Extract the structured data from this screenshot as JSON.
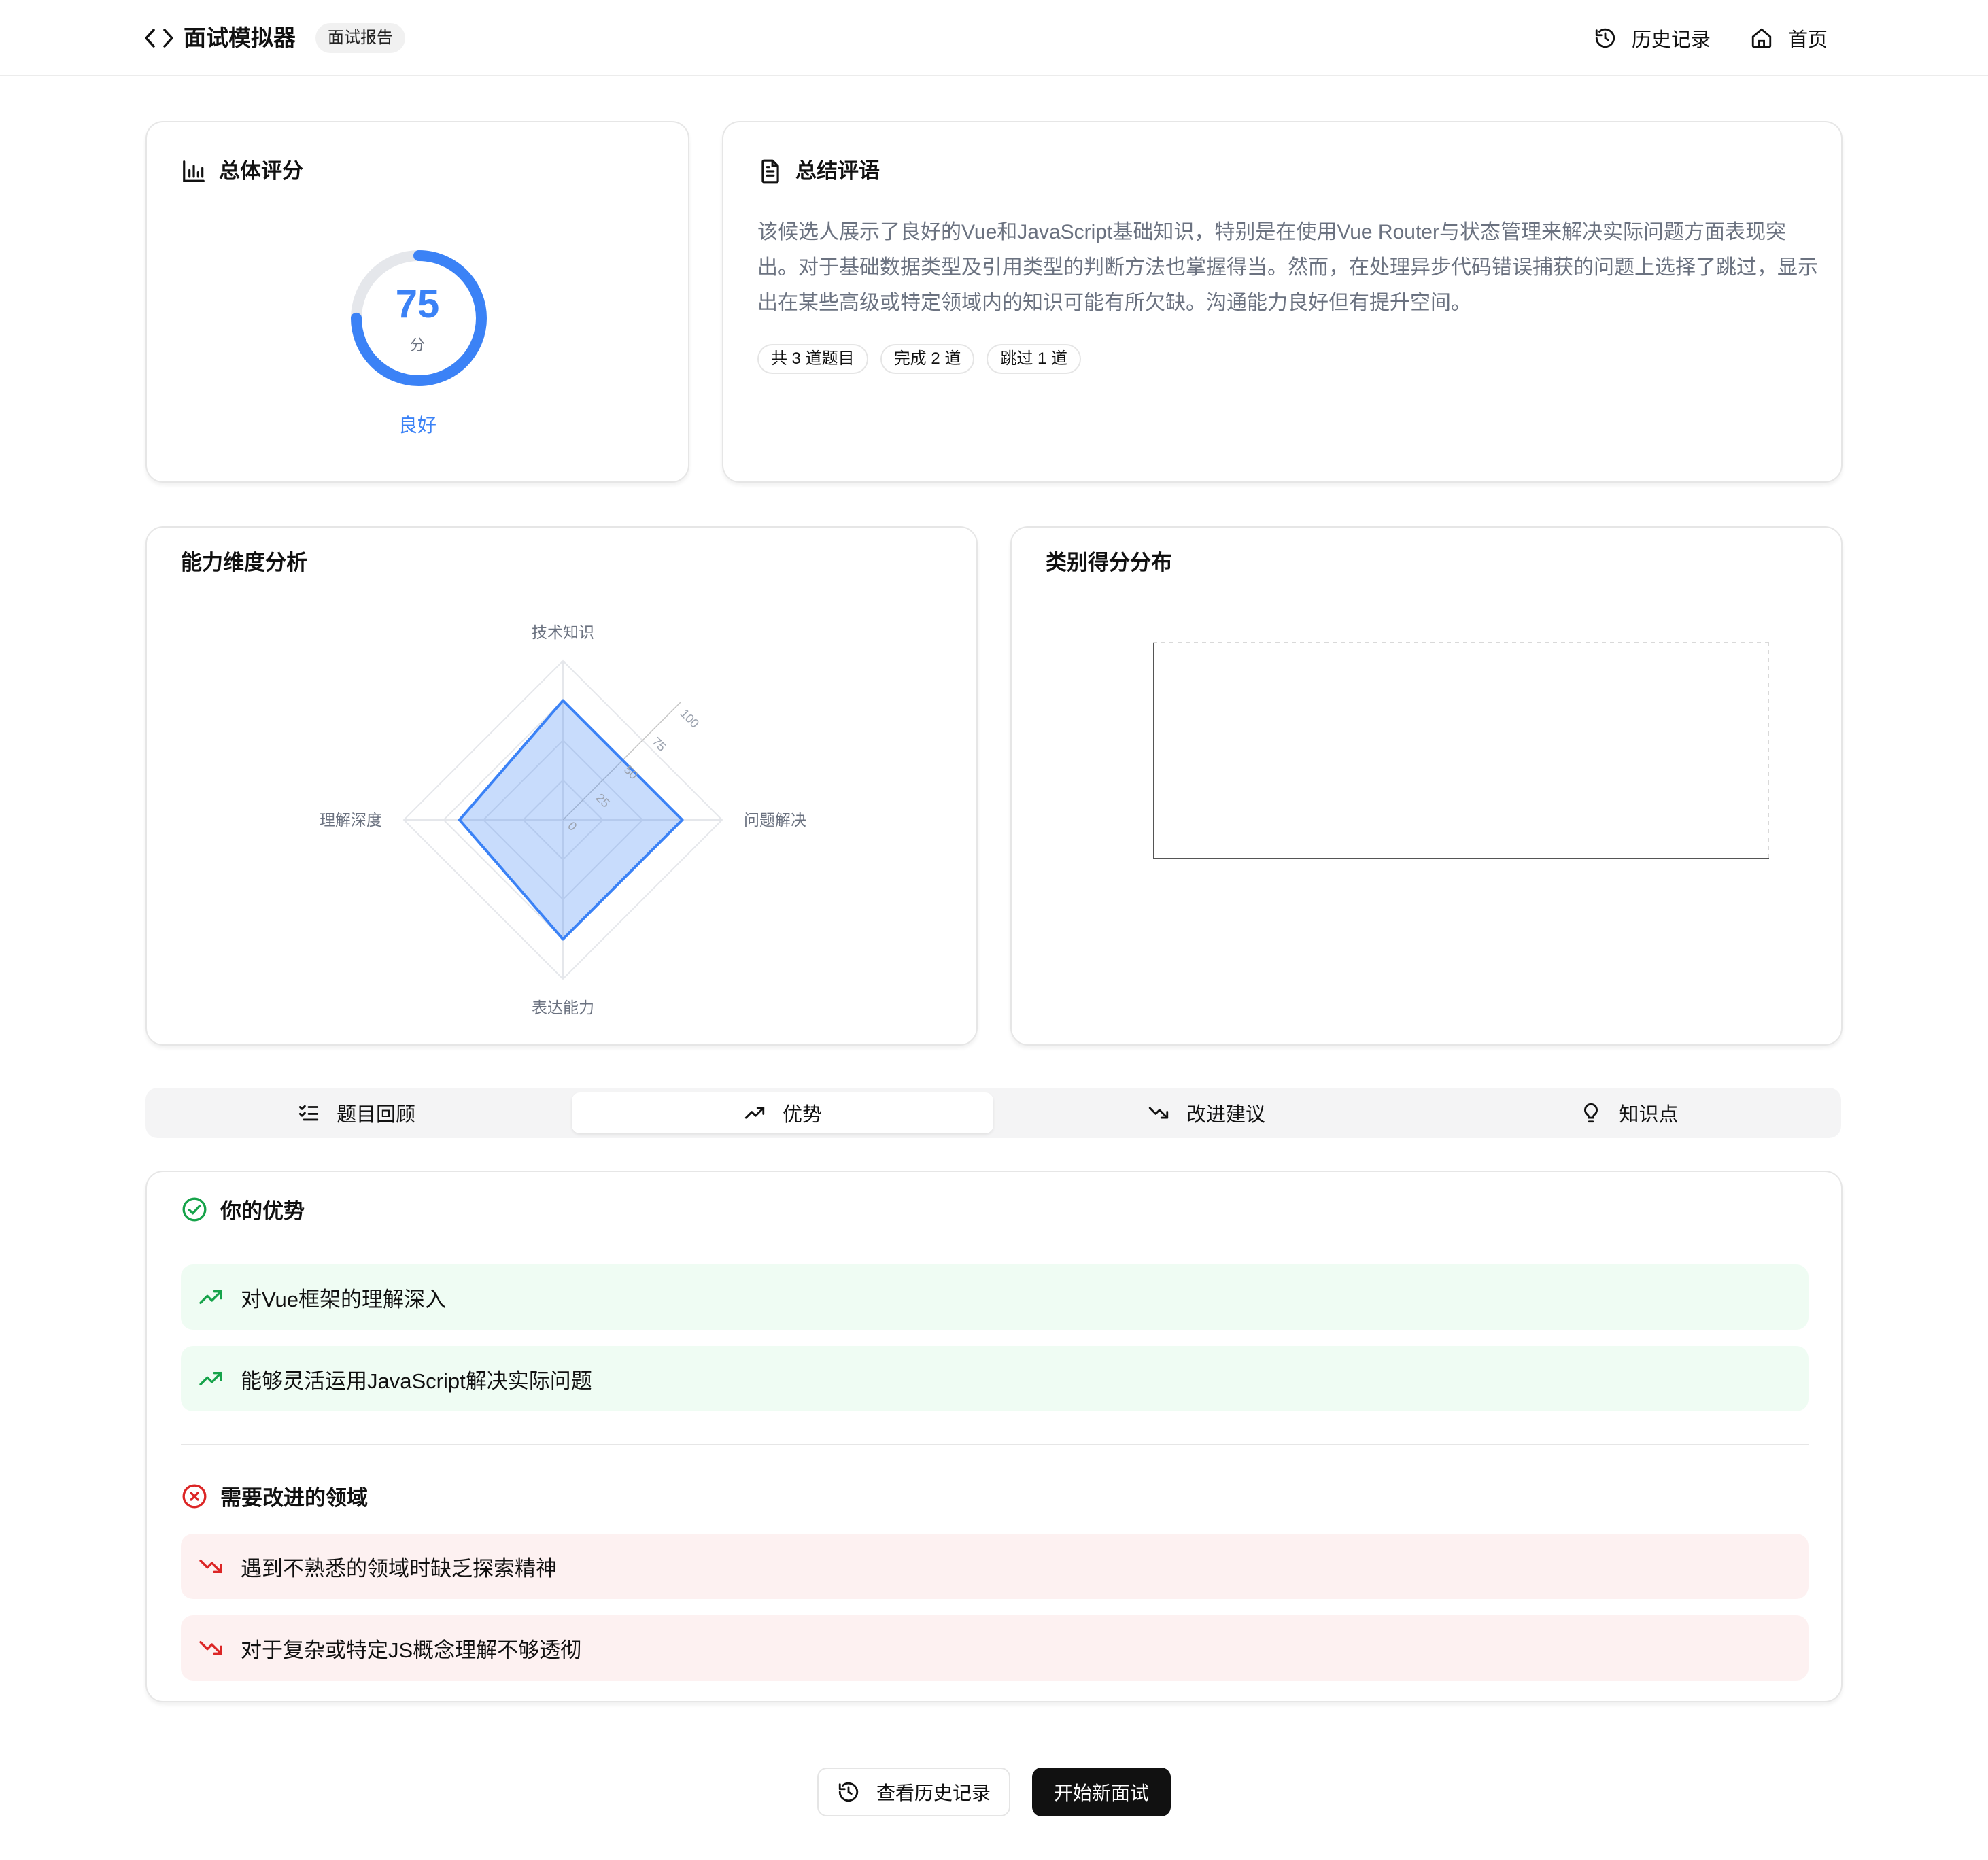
{
  "header": {
    "app_title": "面试模拟器",
    "badge": "面试报告",
    "nav": [
      {
        "label": "历史记录",
        "icon": "history-icon"
      },
      {
        "label": "首页",
        "icon": "home-icon"
      }
    ]
  },
  "overall": {
    "title": "总体评分",
    "score": "75",
    "score_value": 75,
    "unit": "分",
    "level": "良好"
  },
  "summary": {
    "title": "总结评语",
    "text": "该候选人展示了良好的Vue和JavaScript基础知识，特别是在使用Vue Router与状态管理来解决实际问题方面表现突出。对于基础数据类型及引用类型的判断方法也掌握得当。然而，在处理异步代码错误捕获的问题上选择了跳过，显示出在某些高级或特定领域内的知识可能有所欠缺。沟通能力良好但有提升空间。",
    "chips": [
      "共 3 道题目",
      "完成 2 道",
      "跳过 1 道"
    ]
  },
  "radar": {
    "title": "能力维度分析"
  },
  "category": {
    "title": "类别得分分布"
  },
  "chart_data": {
    "type": "radar",
    "axes": [
      "技术知识",
      "问题解决",
      "表达能力",
      "理解深度"
    ],
    "values": [
      75,
      75,
      75,
      65
    ],
    "rlim": [
      0,
      100
    ],
    "ticks": [
      "0",
      "25",
      "50",
      "75",
      "100"
    ],
    "color": "#3b82f6"
  },
  "tabs": [
    {
      "label": "题目回顾",
      "icon": "checklist-icon",
      "active": false
    },
    {
      "label": "优势",
      "icon": "trend-up-icon",
      "active": true
    },
    {
      "label": "改进建议",
      "icon": "trend-down-icon",
      "active": false
    },
    {
      "label": "知识点",
      "icon": "lightbulb-icon",
      "active": false
    }
  ],
  "strengths": {
    "title": "你的优势",
    "items": [
      "对Vue框架的理解深入",
      "能够灵活运用JavaScript解决实际问题"
    ]
  },
  "improvements": {
    "title": "需要改进的领域",
    "items": [
      "遇到不熟悉的领域时缺乏探索精神",
      "对于复杂或特定JS概念理解不够透彻"
    ]
  },
  "buttons": {
    "history": "查看历史记录",
    "new_interview": "开始新面试"
  },
  "colors": {
    "accent": "#3b82f6",
    "good": "#16a34a",
    "bad": "#dc2626",
    "dark": "#111111"
  }
}
